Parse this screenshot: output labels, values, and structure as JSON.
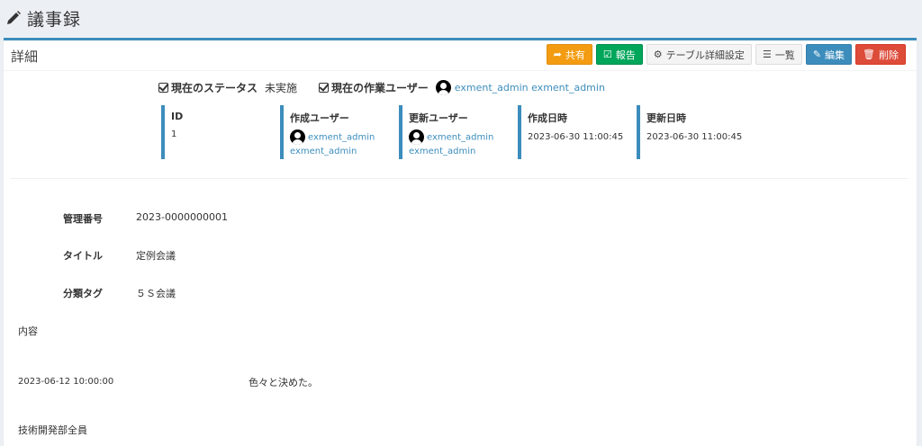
{
  "page": {
    "title": "議事録"
  },
  "box": {
    "title": "詳細"
  },
  "toolbar": {
    "share": "共有",
    "report": "報告",
    "table_settings": "テーブル詳細設定",
    "list": "一覧",
    "edit": "編集",
    "delete": "削除"
  },
  "status": {
    "current_status_label": "現在のステータス",
    "current_status_value": "未実施",
    "current_user_label": "現在の作業ユーザー",
    "current_user_value": "exment_admin exment_admin"
  },
  "info": {
    "id_label": "ID",
    "id_value": "1",
    "created_user_label": "作成ユーザー",
    "created_user_name": "exment_admin",
    "created_user_name2": "exment_admin",
    "updated_user_label": "更新ユーザー",
    "updated_user_name": "exment_admin",
    "updated_user_name2": "exment_admin",
    "created_at_label": "作成日時",
    "created_at_value": "2023-06-30 11:00:45",
    "updated_at_label": "更新日時",
    "updated_at_value": "2023-06-30 11:00:45"
  },
  "fields": {
    "manage_no_label": "管理番号",
    "manage_no_value": "2023-0000000001",
    "title_label": "タイトル",
    "title_value": "定例会議",
    "tag_label": "分類タグ",
    "tag_value": "５Ｓ会議"
  },
  "content": {
    "label": "内容",
    "date": "2023-06-12 10:00:00",
    "text": "色々と決めた。",
    "attendees": "技術開発部全員"
  },
  "colors": {
    "primary": "#3c8dbc",
    "warning": "#f39c12",
    "success": "#00a65a",
    "danger": "#dd4b39",
    "background": "#ecf0f5"
  }
}
